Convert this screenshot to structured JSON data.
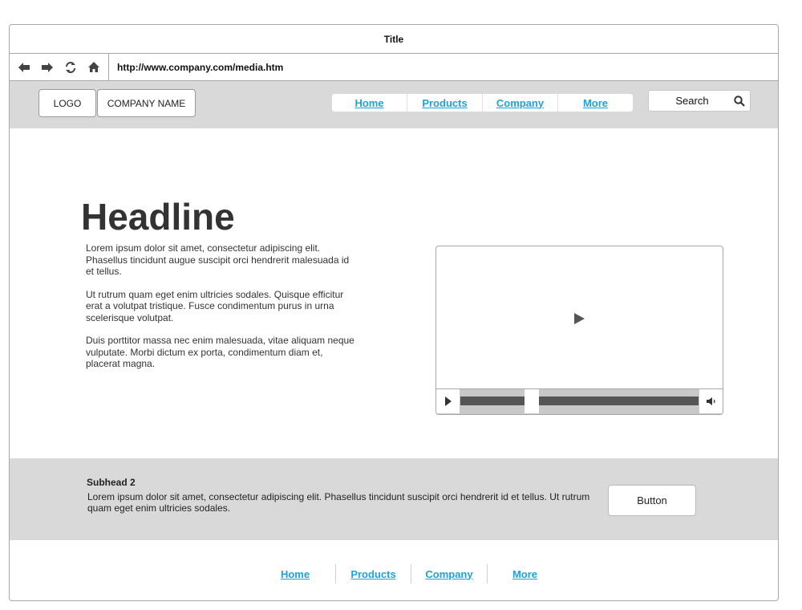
{
  "window": {
    "title": "Title"
  },
  "browser": {
    "url": "http://www.company.com/media.htm",
    "buttons": [
      "back-arrow-icon",
      "forward-arrow-icon",
      "refresh-icon",
      "home-icon"
    ]
  },
  "header": {
    "logo": "LOGO",
    "company_name": "COMPANY NAME",
    "nav": [
      "Home",
      "Products",
      "Company",
      "More"
    ],
    "search_label": "Search"
  },
  "main": {
    "headline": "Headline",
    "paragraphs": [
      "Lorem ipsum dolor sit amet, consectetur adipiscing elit. Phasellus tincidunt augue suscipit orci hendrerit malesuada id et tellus.",
      "Ut rutrum quam eget enim ultricies sodales. Quisque efficitur erat a volutpat tristique. Fusce condimentum purus in urna scelerisque volutpat.",
      "Duis porttitor massa nec enim malesuada, vitae aliquam neque vulputate. Morbi dictum ex porta, condimentum diam et, placerat magna."
    ],
    "video": {
      "progress": 0.3
    }
  },
  "band": {
    "subhead": "Subhead 2",
    "text": "Lorem ipsum dolor sit amet, consectetur adipiscing elit. Phasellus tincidunt suscipit orci hendrerit id et tellus. Ut rutrum quam eget enim ultricies sodales.",
    "button": "Button"
  },
  "footer": {
    "nav": [
      "Home",
      "Products",
      "Company",
      "More"
    ]
  },
  "colors": {
    "link": "#1aa3dc",
    "band": "#d9d9d9",
    "border": "#a8a8a8"
  }
}
